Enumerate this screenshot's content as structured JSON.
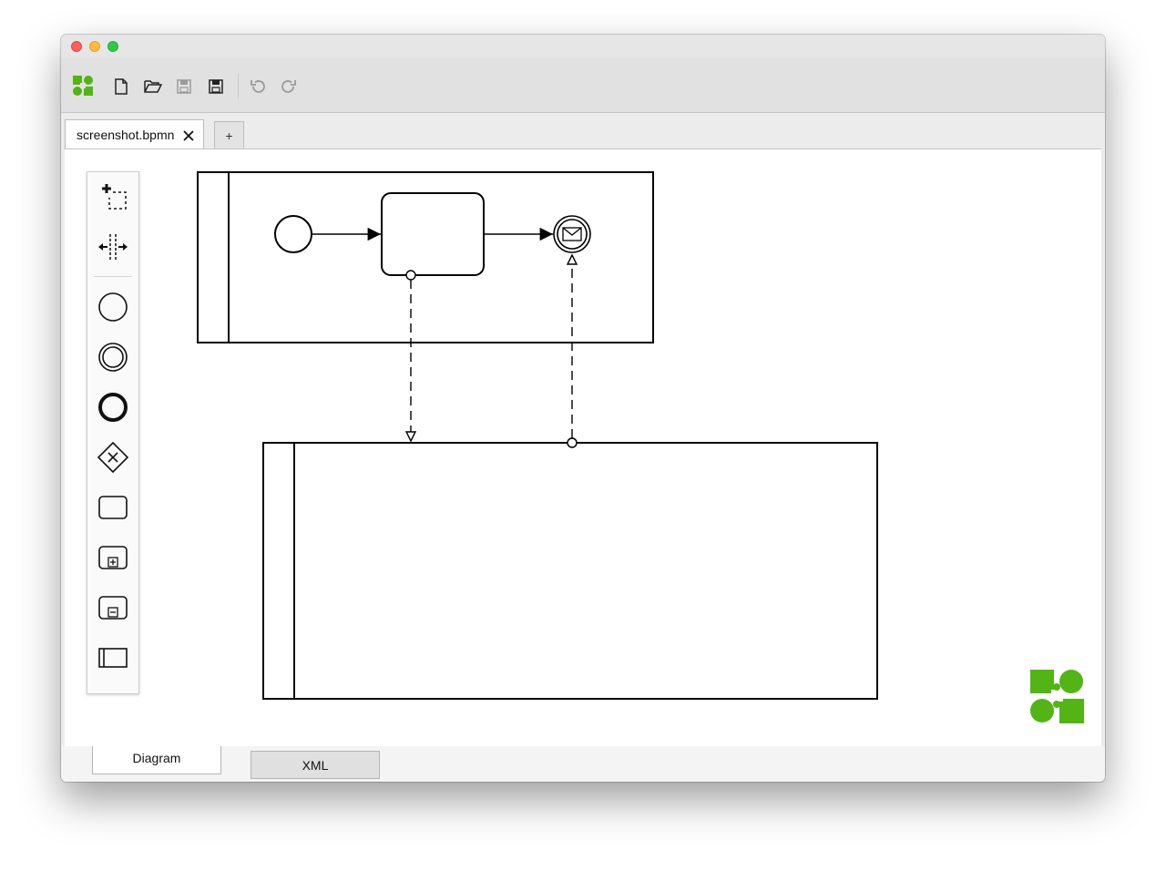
{
  "window": {
    "controls": [
      "close",
      "minimize",
      "zoom"
    ]
  },
  "toolbar": {
    "logo": "bpmn-io-logo-icon",
    "buttons": [
      {
        "name": "new-file-icon",
        "tooltip": ""
      },
      {
        "name": "open-file-icon",
        "tooltip": ""
      },
      {
        "name": "save-icon",
        "tooltip": ""
      },
      {
        "name": "save-as-icon",
        "tooltip": ""
      },
      {
        "name": "undo-icon",
        "tooltip": ""
      },
      {
        "name": "redo-icon",
        "tooltip": ""
      }
    ]
  },
  "tabs": {
    "file_tab_label": "screenshot.bpmn",
    "add_tab_label": "+"
  },
  "palette": {
    "tools": [
      "lasso-tool-icon",
      "space-tool-icon"
    ],
    "elements": [
      "start-event-icon",
      "intermediate-event-icon",
      "end-event-icon",
      "gateway-icon",
      "task-icon",
      "collapsed-subprocess-icon",
      "expanded-subprocess-icon",
      "participant-icon"
    ]
  },
  "footer": {
    "diagram_tab": "Diagram",
    "xml_tab": "XML"
  },
  "colors": {
    "brand_green": "#52b415",
    "toolbar_bg": "#e1e1e1",
    "canvas_bg": "#ffffff",
    "stroke": "#000000"
  }
}
